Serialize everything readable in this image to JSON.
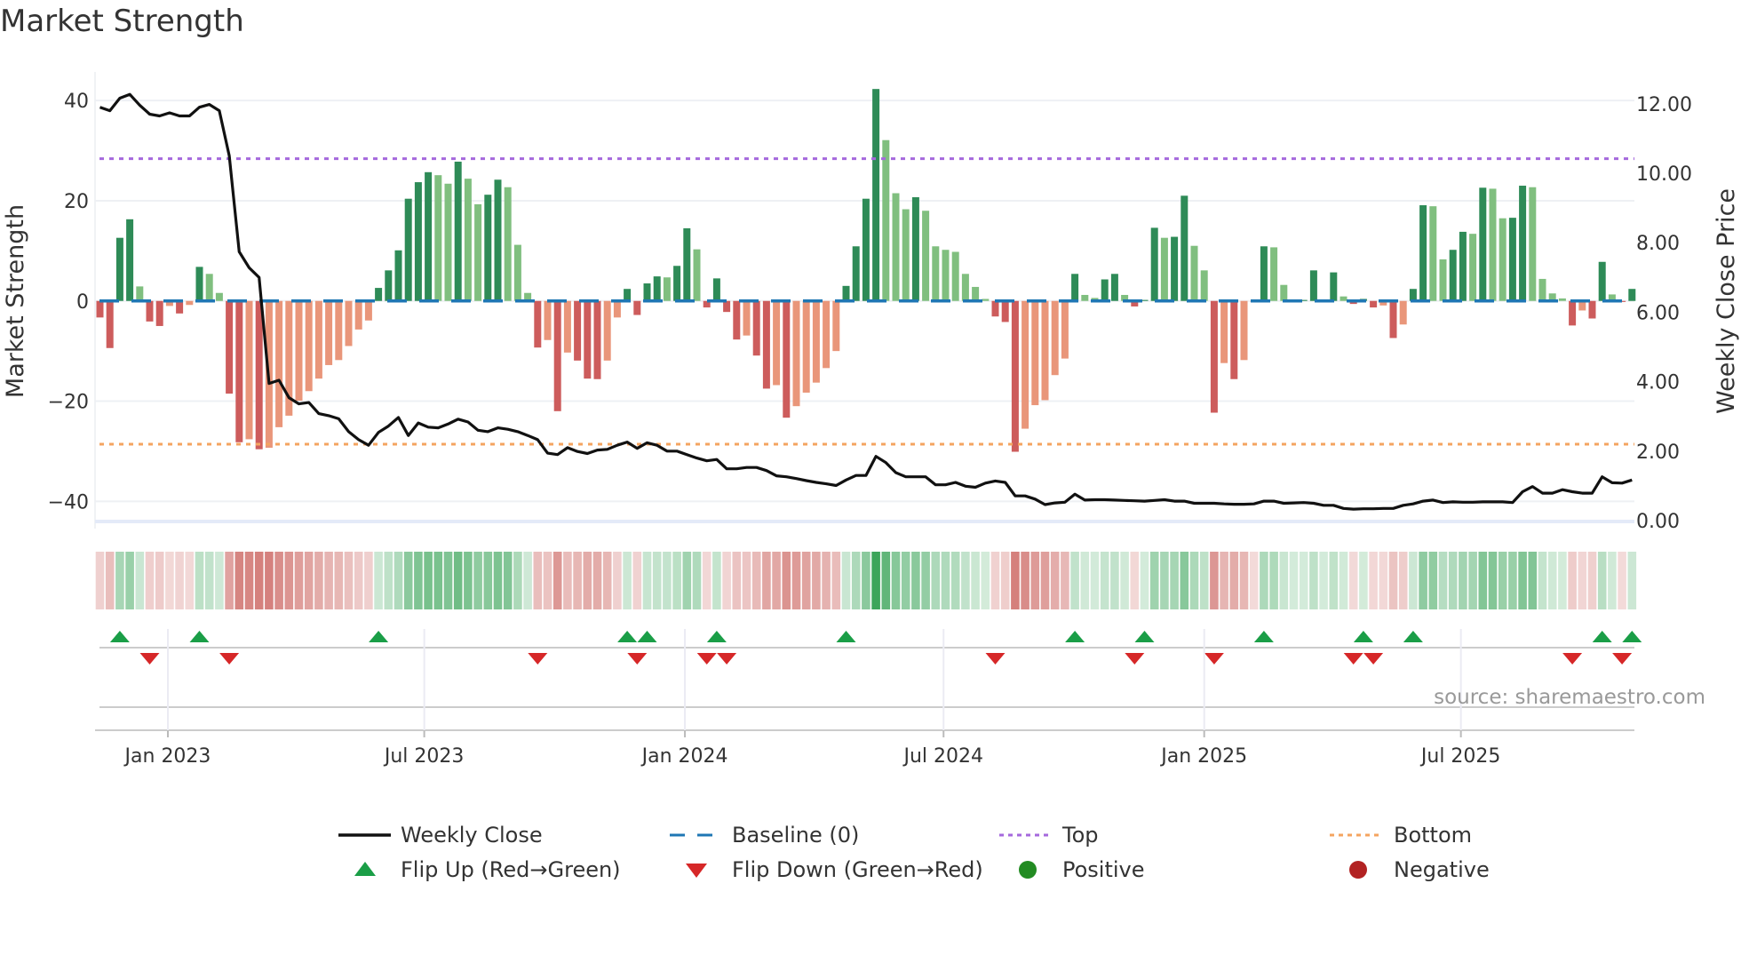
{
  "title": "Market Strength",
  "source": "source: sharemaestro.com",
  "colors": {
    "pos_dark": "#2e8b57",
    "pos_light": "#80bf7f",
    "neg_dark": "#cd5c5c",
    "neg_light": "#e9967a",
    "baseline": "#1f77b4",
    "top": "#a569dd",
    "bottom": "#f4a460",
    "price": "#111111",
    "flip_up": "#1a9e47",
    "flip_down": "#d62728",
    "positive": "#228b22",
    "negative": "#b22222"
  },
  "chart_data": {
    "type": "bar",
    "title": "Market Strength",
    "ylabel": "Market Strength",
    "y2label": "Weekly Close Price",
    "ylim": [
      -44.2,
      45.7
    ],
    "y2lim": [
      0,
      13.1
    ],
    "yticks": [
      40,
      20,
      0,
      -20,
      -40
    ],
    "y2ticks": [
      "0.00",
      "2.00",
      "4.00",
      "6.00",
      "8.00",
      "10.00",
      "12.00"
    ],
    "top_level": 28.4,
    "bottom_level": -28.6,
    "xticks": [
      {
        "label": "Jan 2023",
        "week_index": 7.83
      },
      {
        "label": "Jul 2023",
        "week_index": 33.6
      },
      {
        "label": "Jan 2024",
        "week_index": 59.8
      },
      {
        "label": "Jul 2024",
        "week_index": 85.8
      },
      {
        "label": "Jan 2025",
        "week_index": 112.0
      },
      {
        "label": "Jul 2025",
        "week_index": 137.8
      }
    ],
    "strength": [
      -3.3,
      -9.4,
      12.6,
      16.3,
      2.9,
      -4.1,
      -5,
      -1,
      -2.5,
      -0.8,
      6.8,
      5.4,
      1.6,
      -18.5,
      -28.2,
      -27.6,
      -29.6,
      -29.3,
      -25.2,
      -22.9,
      -19.9,
      -18,
      -15.5,
      -12.8,
      -11.8,
      -9,
      -5.7,
      -3.9,
      2.6,
      6.1,
      10.1,
      20.4,
      23.7,
      25.7,
      25.1,
      23.4,
      27.8,
      24.4,
      19.3,
      21.2,
      24.2,
      22.7,
      11.2,
      1.6,
      -9.3,
      -7.8,
      -22,
      -10.3,
      -11.9,
      -15.5,
      -15.6,
      -11.9,
      -3.3,
      2.4,
      -2.8,
      3.5,
      4.9,
      4.7,
      7,
      14.5,
      10.3,
      -1.3,
      4.5,
      -2.2,
      -7.7,
      -6.9,
      -10.9,
      -17.5,
      -16.8,
      -23.3,
      -21,
      -18.3,
      -16.3,
      -13.4,
      -10,
      3,
      10.9,
      20.4,
      42.3,
      32.1,
      21.5,
      18.3,
      20.7,
      18,
      10.9,
      10.2,
      9.8,
      5.4,
      2.8,
      0.4,
      -3.1,
      -4.2,
      -30.1,
      -25.5,
      -20.8,
      -19.8,
      -14.8,
      -11.5,
      5.4,
      1.2,
      0.6,
      4.3,
      5.4,
      1.2,
      -1.1,
      0.2,
      14.6,
      12.6,
      12.8,
      21,
      11,
      6.1,
      -22.3,
      -12.4,
      -15.6,
      -11.8,
      -0.2,
      10.9,
      10.7,
      3.2,
      0.2,
      0.2,
      6.1,
      0.2,
      5.7,
      0.9,
      -0.6,
      0.4,
      -1.3,
      -0.9,
      -7.4,
      -4.7,
      2.4,
      19.1,
      18.9,
      8.3,
      10.2,
      13.8,
      13.4,
      22.6,
      22.4,
      16.5,
      16.6,
      23,
      22.7,
      4.4,
      1.5,
      0.5,
      -4.9,
      -1.9,
      -3.5,
      7.8,
      1.3,
      -0.2,
      2.4
    ],
    "weekly_close": [
      11.9,
      11.8,
      12.16,
      12.27,
      11.96,
      11.7,
      11.65,
      11.74,
      11.65,
      11.65,
      11.9,
      11.98,
      11.8,
      10.5,
      7.74,
      7.28,
      7.0,
      3.95,
      4.04,
      3.54,
      3.36,
      3.4,
      3.08,
      3.02,
      2.93,
      2.56,
      2.33,
      2.17,
      2.54,
      2.72,
      2.97,
      2.45,
      2.81,
      2.69,
      2.67,
      2.78,
      2.92,
      2.84,
      2.6,
      2.56,
      2.67,
      2.63,
      2.56,
      2.45,
      2.33,
      1.94,
      1.9,
      2.1,
      1.99,
      1.93,
      2.03,
      2.05,
      2.17,
      2.26,
      2.08,
      2.24,
      2.17,
      2.0,
      2.0,
      1.9,
      1.8,
      1.72,
      1.76,
      1.49,
      1.49,
      1.53,
      1.53,
      1.44,
      1.29,
      1.26,
      1.21,
      1.15,
      1.1,
      1.06,
      1.01,
      1.17,
      1.3,
      1.3,
      1.85,
      1.67,
      1.38,
      1.26,
      1.26,
      1.26,
      1.03,
      1.03,
      1.1,
      0.99,
      0.96,
      1.08,
      1.14,
      1.1,
      0.71,
      0.71,
      0.62,
      0.46,
      0.51,
      0.53,
      0.76,
      0.59,
      0.6,
      0.6,
      0.59,
      0.58,
      0.57,
      0.56,
      0.58,
      0.6,
      0.56,
      0.56,
      0.5,
      0.5,
      0.5,
      0.48,
      0.47,
      0.47,
      0.48,
      0.56,
      0.56,
      0.5,
      0.51,
      0.52,
      0.5,
      0.44,
      0.44,
      0.35,
      0.33,
      0.34,
      0.34,
      0.35,
      0.35,
      0.44,
      0.48,
      0.56,
      0.59,
      0.52,
      0.54,
      0.53,
      0.53,
      0.54,
      0.54,
      0.54,
      0.52,
      0.83,
      0.98,
      0.79,
      0.79,
      0.89,
      0.83,
      0.79,
      0.79,
      1.26,
      1.09,
      1.08,
      1.17
    ],
    "legend": {
      "placement": "bottom",
      "entries": [
        "Weekly Close",
        "Baseline (0)",
        "Top",
        "Bottom",
        "Flip Up (Red→Green)",
        "Flip Down (Green→Red)",
        "Positive",
        "Negative"
      ]
    }
  }
}
